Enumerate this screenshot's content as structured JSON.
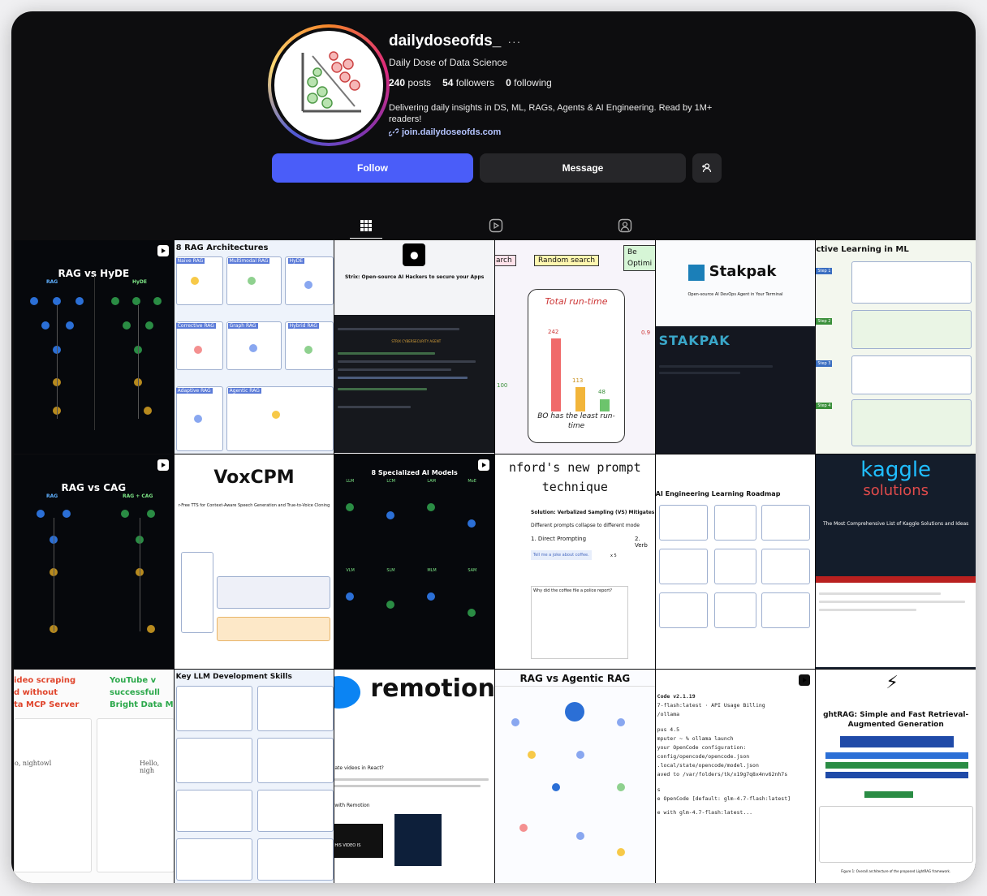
{
  "profile": {
    "username": "dailydoseofds_",
    "more": "···",
    "full_name": "Daily Dose of Data Science",
    "stats": {
      "posts_count": "240",
      "posts_label": "posts",
      "followers_count": "54",
      "followers_label": "followers",
      "following_count": "0",
      "following_label": "following"
    },
    "bio": "Delivering daily insights in DS, ML, RAGs, Agents & AI Engineering. Read by 1M+ readers!",
    "link": "join.dailydoseofds.com"
  },
  "actions": {
    "follow": "Follow",
    "message": "Message"
  },
  "tabs": [
    "posts-grid-icon",
    "reels-icon",
    "tagged-icon"
  ],
  "colors": {
    "follow": "#4a5df9",
    "secondary": "#262629",
    "background": "#0d0d0f"
  },
  "posts": [
    {
      "title": "RAG vs HyDE",
      "sub1": "RAG",
      "sub2": "HyDE"
    },
    {
      "title": "8 RAG Architectures",
      "labels": [
        "Naive RAG",
        "Multimodal RAG",
        "HyDE",
        "Corrective RAG",
        "Graph RAG",
        "Hybrid RAG",
        "Adaptive RAG",
        "Agentic RAG"
      ]
    },
    {
      "title": "Strix: Open-source AI Hackers to secure your Apps",
      "line": "STRIX CYBERSECURITY AGENT"
    },
    {
      "labels": [
        "arch",
        "Random search",
        "Be",
        "Optimi"
      ],
      "chart_title": "Total run-time",
      "values": [
        "242",
        "113",
        "48",
        "100",
        "0.9"
      ],
      "caption": "BO has the least run-time"
    },
    {
      "title": "Stakpak",
      "subtitle": "Open-source AI DevOps Agent in Your Terminal",
      "banner": "STAKPAK"
    },
    {
      "title": "ctive Learning in ML",
      "steps": [
        "Step 1",
        "Step 2",
        "Step 3",
        "Step 4"
      ]
    },
    {
      "title": "RAG vs CAG",
      "sub1": "RAG",
      "sub2": "RAG + CAG"
    },
    {
      "title": "VoxCPM",
      "subtitle": "r-Free TTS for Context-Aware Speech Generation and True-to-Voice Cloning"
    },
    {
      "title": "8 Specialized AI Models",
      "labels": [
        "LLM",
        "LCM",
        "LAM",
        "MoE",
        "VLM",
        "SLM",
        "MLM",
        "SAM"
      ]
    },
    {
      "title": "nford's new prompt technique",
      "solution": "Solution: Verbalized Sampling (VS) Mitigates",
      "subtitle": "Different prompts collapse to different mode",
      "heading": "1. Direct Prompting",
      "heading2": "2. Verb",
      "prompt": "Tell me a joke about coffee.",
      "times": "x 5",
      "answer": "Why did the coffee file a police report?"
    },
    {
      "title": "AI Engineering Learning Roadmap"
    },
    {
      "title": "kaggle",
      "title2": "solutions",
      "subtitle": "The Most Comprehensive List of Kaggle Solutions and Ideas"
    },
    {
      "lines": [
        "ideo scraping",
        "d without",
        "ta MCP Server"
      ],
      "lines2": [
        "YouTube v",
        "successfull",
        "Bright Data M"
      ],
      "handle": "o, nightowl",
      "handle2": "Hello, nigh"
    },
    {
      "title": "Key LLM Development Skills"
    },
    {
      "title": "remotion",
      "caption1": "ate videos in React?",
      "caption2": "with Remotion",
      "caption3": "HIS VIDEO IS"
    },
    {
      "title": "RAG vs Agentic RAG"
    },
    {
      "lines": [
        "Code v2.1.19",
        "7-flash:latest · API Usage Billing",
        "/ollama",
        "pus 4.5",
        "mputer ~ % ollama launch",
        " your OpenCode configuration:",
        "config/opencode/opencode.json",
        ".local/state/opencode/model.json",
        "aved to /var/folders/tk/x19g7q8x4nv62nh7s",
        "s",
        "e OpenCode [default: glm-4.7-flash:latest]",
        "e with glm-4.7-flash:latest..."
      ]
    },
    {
      "title": "ghtRAG: Simple and Fast Retrieval-Augmented Generation",
      "caption": "Figure 1: Overall architecture of the proposed LightRAG framework."
    }
  ]
}
